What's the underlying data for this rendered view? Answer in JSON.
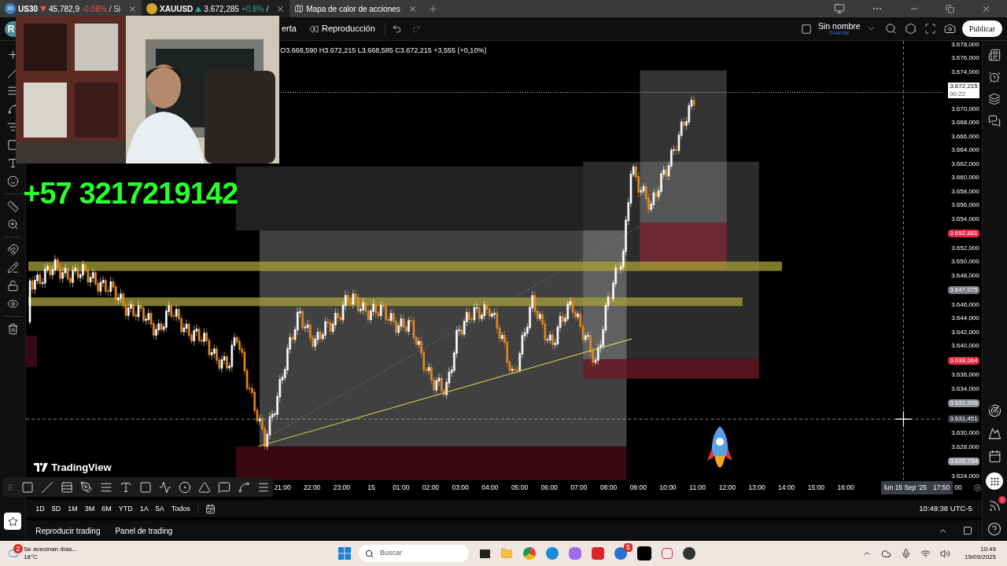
{
  "browser_tabs": [
    {
      "kind": "quote",
      "badge": "30",
      "symbol": "US30",
      "rising": false,
      "price": "45.782,9",
      "change": "-0.08%",
      "color": "#ef5350",
      "rest": "/ Si",
      "selected": false
    },
    {
      "kind": "quote",
      "symbol": "XAUUSD",
      "rising": true,
      "price": "3.672,285",
      "change": "+0.8%",
      "color": "#26a69a",
      "rest": "/",
      "selected": true
    },
    {
      "kind": "page",
      "title": "Mapa de calor de acciones",
      "selected": false
    }
  ],
  "header": {
    "avatar": "R",
    "alert": "erta",
    "replay": "Reproducción",
    "layout_name": "Sin nombre",
    "save": "Guardar",
    "publish": "Publicar"
  },
  "legend": "O3.668,590 H3.672,215 L3.668,585 C3.672,215 +3,555 (+0,10%)",
  "phone": "+57 3217219142",
  "logo": "TradingView",
  "price_axis": [
    {
      "kind": "tick",
      "label": "3.678,000"
    },
    {
      "kind": "tick",
      "label": "3.676,000"
    },
    {
      "kind": "tick",
      "label": "3.674,000"
    },
    {
      "kind": "current",
      "label": "3.672,215",
      "sub": "00:22",
      "color": "#ffffff"
    },
    {
      "kind": "tick",
      "label": "3.670,000"
    },
    {
      "kind": "tick",
      "label": "3.668,000"
    },
    {
      "kind": "tick",
      "label": "3.666,000"
    },
    {
      "kind": "tick",
      "label": "3.664,000"
    },
    {
      "kind": "tick",
      "label": "3.662,000"
    },
    {
      "kind": "tick",
      "label": "3.660,000"
    },
    {
      "kind": "tick",
      "label": "3.658,000"
    },
    {
      "kind": "tick",
      "label": "3.656,000"
    },
    {
      "kind": "tick",
      "label": "3.654,000"
    },
    {
      "kind": "badge",
      "label": "3.652,881",
      "color": "#e0263f"
    },
    {
      "kind": "tick",
      "label": "3.652,000"
    },
    {
      "kind": "tick",
      "label": "3.650,000"
    },
    {
      "kind": "tick",
      "label": "3.648,000"
    },
    {
      "kind": "badge",
      "label": "3.647,075",
      "color": "#7b7d85"
    },
    {
      "kind": "tick",
      "label": "3.646,000"
    },
    {
      "kind": "tick",
      "label": "3.644,000"
    },
    {
      "kind": "tick",
      "label": "3.642,000"
    },
    {
      "kind": "tick",
      "label": "3.640,000"
    },
    {
      "kind": "badge",
      "label": "3.638,064",
      "color": "#e0263f"
    },
    {
      "kind": "tick",
      "label": "3.636,000"
    },
    {
      "kind": "tick",
      "label": "3.634,000"
    },
    {
      "kind": "badge",
      "label": "3.632,935",
      "color": "#8e9098"
    },
    {
      "kind": "badge",
      "label": "3.631,451",
      "color": "#3a3d46"
    },
    {
      "kind": "tick",
      "label": "3.630,000"
    },
    {
      "kind": "tick",
      "label": "3.628,000"
    },
    {
      "kind": "badge",
      "label": "3.625,734",
      "color": "#9a9ca3"
    },
    {
      "kind": "tick",
      "label": "3.624,000"
    }
  ],
  "time_axis": {
    "labels": [
      "21:00",
      "22:00",
      "23:00",
      "15",
      "01:00",
      "02:00",
      "03:00",
      "04:00",
      "05:00",
      "06:00",
      "07:00",
      "08:00",
      "09:00",
      "10:00",
      "11:00",
      "12:00",
      "13:00",
      "14:00",
      "15:00",
      "16:00"
    ],
    "cursor_date": "lun 15 Sep '25",
    "cursor_time": "17:50",
    "tail": "00"
  },
  "ranges": [
    "1D",
    "5D",
    "1M",
    "3M",
    "6M",
    "YTD",
    "1A",
    "5A",
    "Todos"
  ],
  "clock": "10:49:38 UTC-5",
  "panel_tabs": [
    "Reproducir trading",
    "Panel de trading"
  ],
  "sidebar_badge": "2",
  "taskbar": {
    "weather_badge": "2",
    "weather_text": "Se avecinan días...",
    "temperature": "18°C",
    "search_placeholder": "Buscar",
    "app_badge": "5",
    "time": "10:49",
    "date": "15/09/2025"
  }
}
